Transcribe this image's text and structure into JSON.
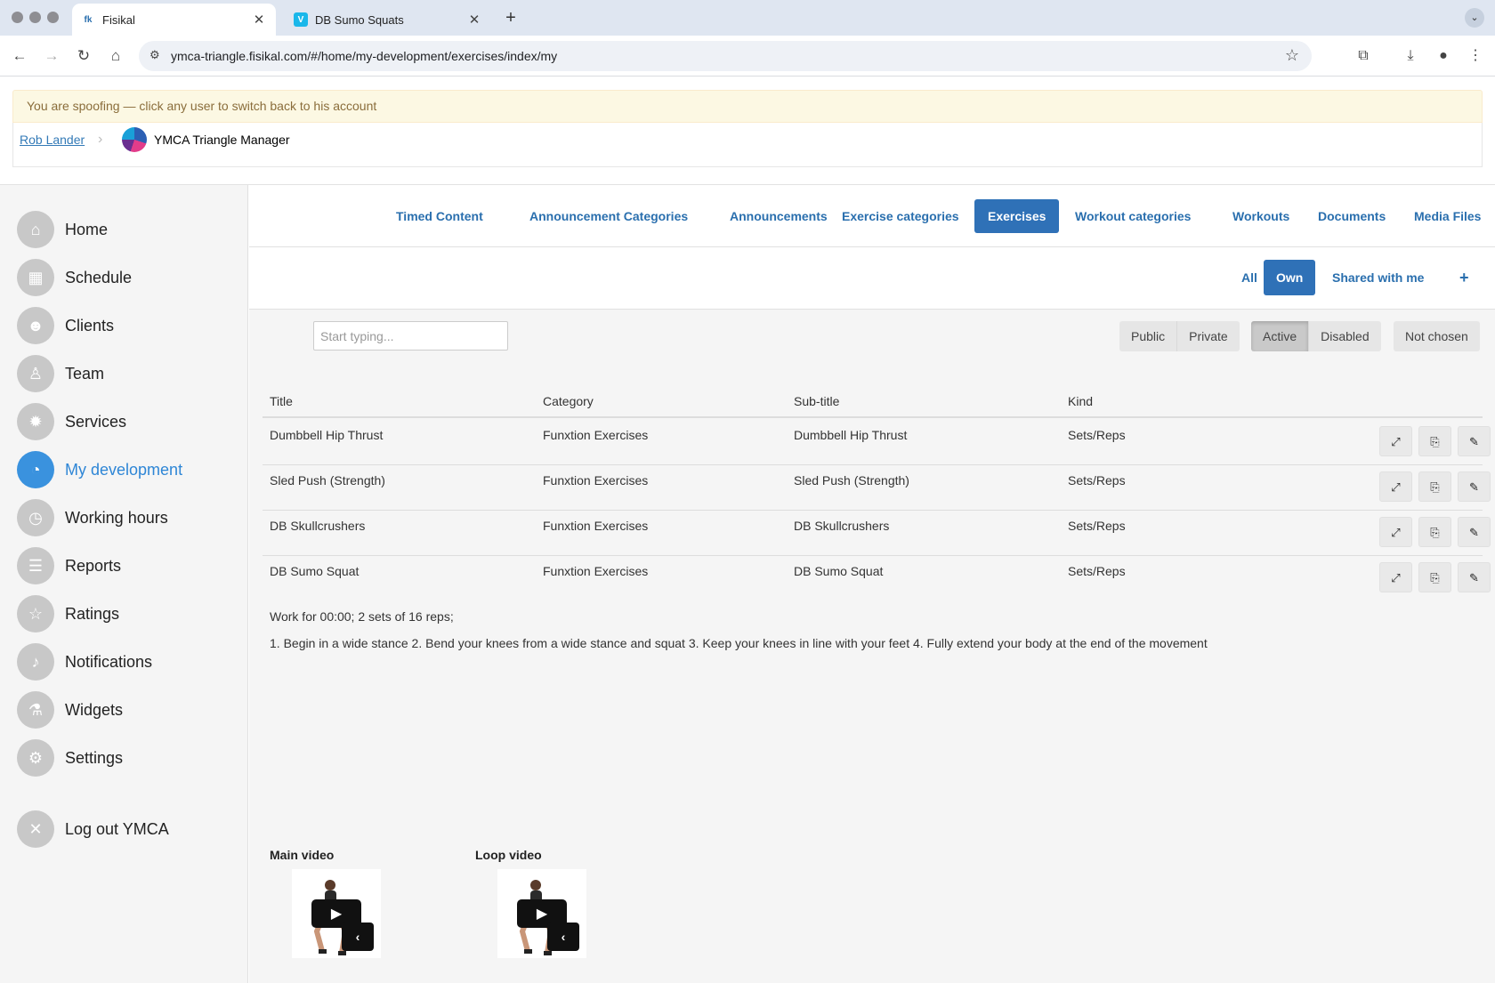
{
  "browser": {
    "tabs": [
      {
        "title": "Fisikal",
        "favicon": "fk"
      },
      {
        "title": "DB Sumo Squats",
        "favicon": "V"
      }
    ],
    "url": "ymca-triangle.fisikal.com/#/home/my-development/exercises/index/my"
  },
  "spoof": {
    "message": "You are spoofing — click any user to switch back to his account",
    "user": "Rob Lander",
    "manager": "YMCA Triangle Manager"
  },
  "sidebar": {
    "items": [
      {
        "label": "Home",
        "icon": "home-icon"
      },
      {
        "label": "Schedule",
        "icon": "calendar-icon"
      },
      {
        "label": "Clients",
        "icon": "clients-icon"
      },
      {
        "label": "Team",
        "icon": "team-icon"
      },
      {
        "label": "Services",
        "icon": "services-icon"
      },
      {
        "label": "My development",
        "icon": "dashboard-icon"
      },
      {
        "label": "Working hours",
        "icon": "clock-icon"
      },
      {
        "label": "Reports",
        "icon": "reports-icon"
      },
      {
        "label": "Ratings",
        "icon": "star-icon"
      },
      {
        "label": "Notifications",
        "icon": "bell-icon"
      },
      {
        "label": "Widgets",
        "icon": "flask-icon"
      },
      {
        "label": "Settings",
        "icon": "gear-icon"
      }
    ],
    "logout": "Log out YMCA"
  },
  "topnav": [
    "Timed Content",
    "Announcement Categories",
    "Announcements",
    "Exercise categories",
    "Exercises",
    "Workout categories",
    "Workouts",
    "Documents",
    "Media Files"
  ],
  "subnav": {
    "all": "All",
    "own": "Own",
    "shared": "Shared with me",
    "add": "+"
  },
  "search": {
    "placeholder": "Start typing..."
  },
  "filters": {
    "visibility": [
      "Public",
      "Private"
    ],
    "status": [
      "Active",
      "Disabled"
    ],
    "choice": [
      "Not chosen"
    ]
  },
  "table": {
    "headers": [
      "Title",
      "Category",
      "Sub-title",
      "Kind"
    ],
    "rows": [
      [
        "Dumbbell Hip Thrust",
        "Funxtion Exercises",
        "Dumbbell Hip Thrust",
        "Sets/Reps"
      ],
      [
        "Sled Push (Strength)",
        "Funxtion Exercises",
        "Sled Push (Strength)",
        "Sets/Reps"
      ],
      [
        "DB Skullcrushers",
        "Funxtion Exercises",
        "DB Skullcrushers",
        "Sets/Reps"
      ],
      [
        "DB Sumo Squat",
        "Funxtion Exercises",
        "DB Sumo Squat",
        "Sets/Reps"
      ]
    ]
  },
  "detail": {
    "work": "Work for 00:00; 2 sets of 16 reps;",
    "instructions": "1. Begin in a wide stance 2. Bend your knees from a wide stance and squat 3. Keep your knees in line with your feet 4. Fully extend your body at the end of the movement",
    "main_video": "Main video",
    "loop_video": "Loop video"
  },
  "colors": {
    "accent": "#2f71b7",
    "active_nav": "#3a92de"
  }
}
